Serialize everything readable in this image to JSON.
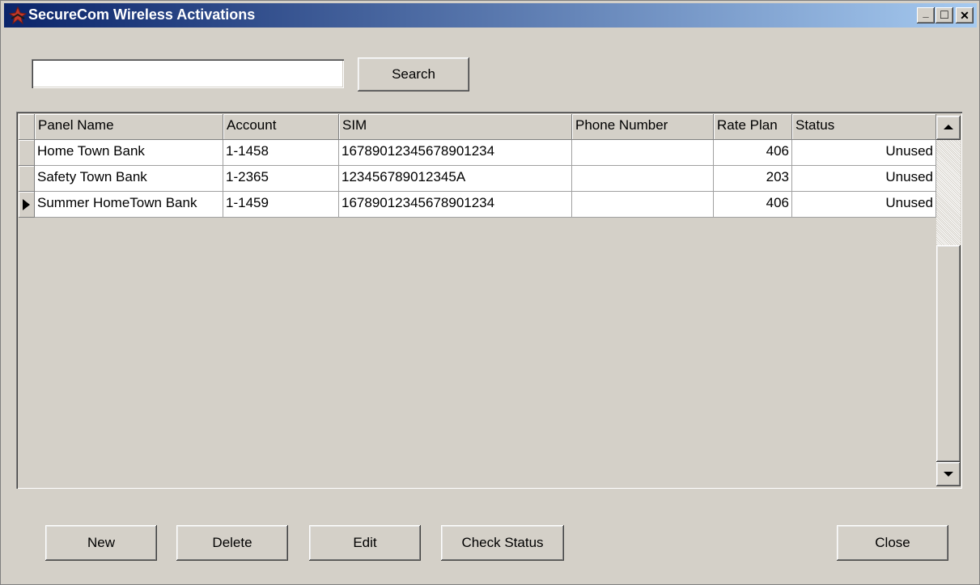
{
  "window": {
    "title": "SecureCom Wireless Activations",
    "controls": {
      "minimize": "_",
      "maximize": "□",
      "close": "✕"
    }
  },
  "search": {
    "value": "",
    "placeholder": "",
    "button_label": "Search"
  },
  "grid": {
    "columns": [
      "Panel Name",
      "Account",
      "SIM",
      "Phone Number",
      "Rate Plan",
      "Status"
    ],
    "rows": [
      {
        "panel_name": "Home Town Bank",
        "account": "1-1458",
        "sim": "16789012345678901234",
        "phone_number": "",
        "rate_plan": "406",
        "status": "Unused",
        "current": false
      },
      {
        "panel_name": "Safety Town Bank",
        "account": "1-2365",
        "sim": "123456789012345A",
        "phone_number": "",
        "rate_plan": "203",
        "status": "Unused",
        "current": false
      },
      {
        "panel_name": "Summer HomeTown Bank",
        "account": "1-1459",
        "sim": "16789012345678901234",
        "phone_number": "",
        "rate_plan": "406",
        "status": "Unused",
        "current": true
      }
    ]
  },
  "buttons": {
    "new": "New",
    "delete": "Delete",
    "edit": "Edit",
    "check_status": "Check Status",
    "close": "Close"
  },
  "colors": {
    "face": "#d4d0c8",
    "title_start": "#0a246a",
    "title_end": "#a6caf0"
  },
  "icons": {
    "app": "securecom-logo-icon",
    "current_row": "row-pointer-icon"
  }
}
